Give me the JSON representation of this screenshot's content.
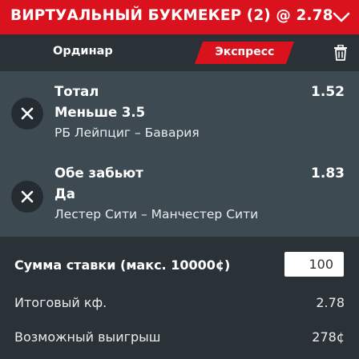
{
  "header": {
    "title": "ВИРТУАЛЬНЫЙ БУКМЕКЕР (2) @ 2.78",
    "collapse_icon": "chevron-down-icon",
    "background_color": "#d9121e"
  },
  "tabs": {
    "single_label": "Ординар",
    "express_label": "Экспресс",
    "active_tab": "Экспресс",
    "clear_icon": "trash-icon"
  },
  "selections": [
    {
      "market": "Тотал",
      "outcome": "Меньше 3.5",
      "match": "РБ Лейпциг – Бавария",
      "odds": "1.52",
      "remove_icon": "close-icon"
    },
    {
      "market": "Обе забьют",
      "outcome": "Да",
      "match": "Лестер Сити – Манчестер Сити",
      "odds": "1.83",
      "remove_icon": "close-icon"
    }
  ],
  "footer": {
    "stake_label": "Сумма ставки (макс. 10000¢)",
    "stake_value": "100",
    "total_odds_label": "Итоговый кф.",
    "total_odds_value": "2.78",
    "potential_win_label": "Возможный выигрыш",
    "potential_win_value": "278¢"
  },
  "colors": {
    "accent": "#d9121e",
    "panel_dark": "#2a3238",
    "panel_mid": "#3e4a52",
    "button_dark": "#242c31"
  }
}
